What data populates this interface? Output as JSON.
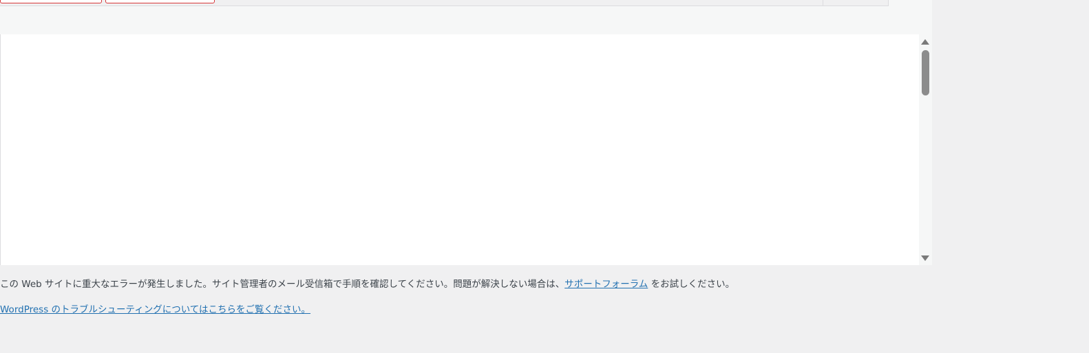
{
  "error": {
    "message_before": "この Web サイトに重大なエラーが発生しました。サイト管理者のメール受信箱で手順を確認してください。問題が解決しない場合は、",
    "support_link": "サポートフォーラム",
    "message_after": " をお試しください。",
    "troubleshooting_link": "WordPress のトラブルシューティングについてはこちらをご覧ください。"
  },
  "colors": {
    "link": "#2271b1",
    "text": "#3c434a",
    "background": "#f0f0f1",
    "button_border": "#d63638"
  },
  "icons": {
    "scroll_up": "triangle-up-icon",
    "scroll_down": "triangle-down-icon"
  }
}
